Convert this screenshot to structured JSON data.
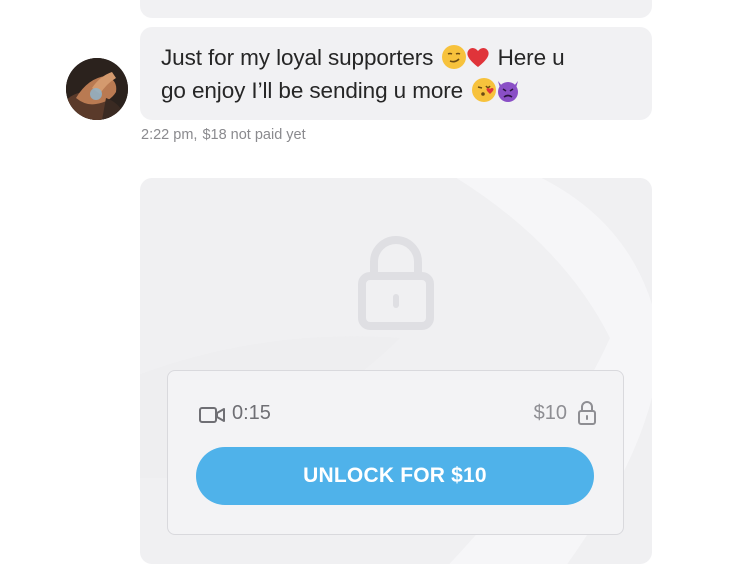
{
  "message": {
    "line1_text": "Just for my loyal supporters",
    "line1_tail": "Here u",
    "line2_text": "go enjoy I’ll be sending u more",
    "emojis": [
      "smirking-face-icon",
      "red-heart-icon",
      "face-blowing-kiss-icon",
      "angry-devil-icon"
    ],
    "time": "2:22 pm,",
    "payment_status": "$18 not paid yet"
  },
  "media": {
    "duration": "0:15",
    "price": "$10",
    "unlock_label": "UNLOCK FOR $10",
    "icons": [
      "lock-icon",
      "video-camera-icon",
      "small-lock-icon"
    ]
  },
  "colors": {
    "bubble_bg": "#f1f1f3",
    "card_bg": "#f0f0f2",
    "accent": "#4fb2ea",
    "meta_text": "#8a8a8e"
  }
}
